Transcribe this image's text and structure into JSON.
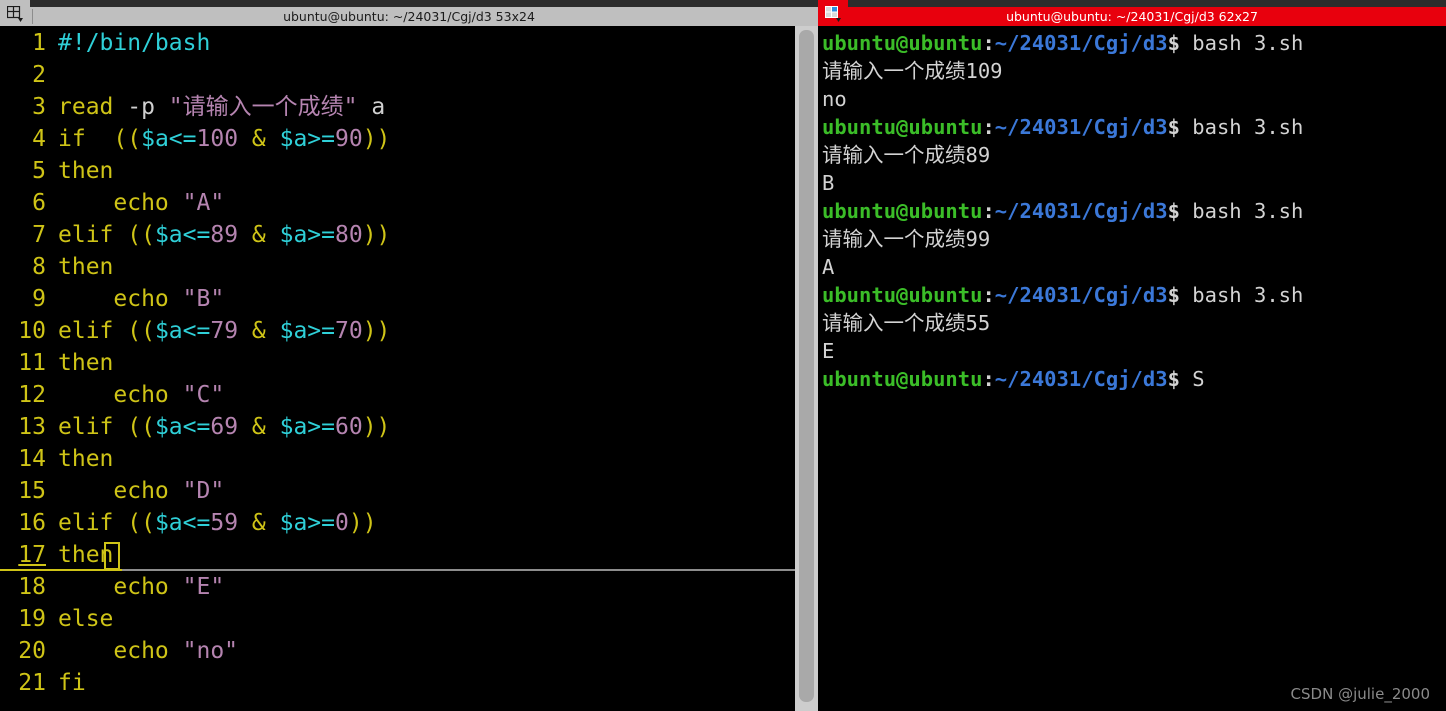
{
  "desktop": {
    "background_color": "#000000",
    "watermark": "CSDN @julie_2000"
  },
  "vim_window": {
    "title": "ubuntu@ubuntu: ~/24031/Cgj/d3 53x24",
    "titlebar_color": "#bfbfbf",
    "state": "inactive",
    "menu_icon": "window-menu-icon",
    "filename_hint": "3.sh",
    "cursor": {
      "line": 17,
      "column": 4,
      "char": "n"
    },
    "lines": [
      {
        "n": "1",
        "tokens": [
          {
            "t": "#!/bin/bash",
            "c": "c-cmt"
          }
        ]
      },
      {
        "n": "2",
        "tokens": []
      },
      {
        "n": "3",
        "tokens": [
          {
            "t": "read",
            "c": "c-kw"
          },
          {
            "t": " -p ",
            "c": "c-plain"
          },
          {
            "t": "\"请输入一个成绩\"",
            "c": "c-str"
          },
          {
            "t": " a",
            "c": "c-plain"
          }
        ]
      },
      {
        "n": "4",
        "tokens": [
          {
            "t": "if",
            "c": "c-kw"
          },
          {
            "t": "  ",
            "c": "c-plain"
          },
          {
            "t": "((",
            "c": "c-kw"
          },
          {
            "t": "$a<=",
            "c": "c-var"
          },
          {
            "t": "100",
            "c": "c-num"
          },
          {
            "t": " & ",
            "c": "c-kw"
          },
          {
            "t": "$a>=",
            "c": "c-var"
          },
          {
            "t": "90",
            "c": "c-num"
          },
          {
            "t": "))",
            "c": "c-kw"
          }
        ]
      },
      {
        "n": "5",
        "tokens": [
          {
            "t": "then",
            "c": "c-kw"
          }
        ]
      },
      {
        "n": "6",
        "tokens": [
          {
            "t": "    ",
            "c": "c-plain"
          },
          {
            "t": "echo",
            "c": "c-kw"
          },
          {
            "t": " ",
            "c": "c-plain"
          },
          {
            "t": "\"A\"",
            "c": "c-str"
          }
        ]
      },
      {
        "n": "7",
        "tokens": [
          {
            "t": "elif",
            "c": "c-kw"
          },
          {
            "t": " ",
            "c": "c-plain"
          },
          {
            "t": "((",
            "c": "c-kw"
          },
          {
            "t": "$a<=",
            "c": "c-var"
          },
          {
            "t": "89",
            "c": "c-num"
          },
          {
            "t": " & ",
            "c": "c-kw"
          },
          {
            "t": "$a>=",
            "c": "c-var"
          },
          {
            "t": "80",
            "c": "c-num"
          },
          {
            "t": "))",
            "c": "c-kw"
          }
        ]
      },
      {
        "n": "8",
        "tokens": [
          {
            "t": "then",
            "c": "c-kw"
          }
        ]
      },
      {
        "n": "9",
        "tokens": [
          {
            "t": "    ",
            "c": "c-plain"
          },
          {
            "t": "echo",
            "c": "c-kw"
          },
          {
            "t": " ",
            "c": "c-plain"
          },
          {
            "t": "\"B\"",
            "c": "c-str"
          }
        ]
      },
      {
        "n": "10",
        "tokens": [
          {
            "t": "elif",
            "c": "c-kw"
          },
          {
            "t": " ",
            "c": "c-plain"
          },
          {
            "t": "((",
            "c": "c-kw"
          },
          {
            "t": "$a<=",
            "c": "c-var"
          },
          {
            "t": "79",
            "c": "c-num"
          },
          {
            "t": " & ",
            "c": "c-kw"
          },
          {
            "t": "$a>=",
            "c": "c-var"
          },
          {
            "t": "70",
            "c": "c-num"
          },
          {
            "t": "))",
            "c": "c-kw"
          }
        ]
      },
      {
        "n": "11",
        "tokens": [
          {
            "t": "then",
            "c": "c-kw"
          }
        ]
      },
      {
        "n": "12",
        "tokens": [
          {
            "t": "    ",
            "c": "c-plain"
          },
          {
            "t": "echo",
            "c": "c-kw"
          },
          {
            "t": " ",
            "c": "c-plain"
          },
          {
            "t": "\"C\"",
            "c": "c-str"
          }
        ]
      },
      {
        "n": "13",
        "tokens": [
          {
            "t": "elif",
            "c": "c-kw"
          },
          {
            "t": " ",
            "c": "c-plain"
          },
          {
            "t": "((",
            "c": "c-kw"
          },
          {
            "t": "$a<=",
            "c": "c-var"
          },
          {
            "t": "69",
            "c": "c-num"
          },
          {
            "t": " & ",
            "c": "c-kw"
          },
          {
            "t": "$a>=",
            "c": "c-var"
          },
          {
            "t": "60",
            "c": "c-num"
          },
          {
            "t": "))",
            "c": "c-kw"
          }
        ]
      },
      {
        "n": "14",
        "tokens": [
          {
            "t": "then",
            "c": "c-kw"
          }
        ]
      },
      {
        "n": "15",
        "tokens": [
          {
            "t": "    ",
            "c": "c-plain"
          },
          {
            "t": "echo",
            "c": "c-kw"
          },
          {
            "t": " ",
            "c": "c-plain"
          },
          {
            "t": "\"D\"",
            "c": "c-str"
          }
        ]
      },
      {
        "n": "16",
        "tokens": [
          {
            "t": "elif",
            "c": "c-kw"
          },
          {
            "t": " ",
            "c": "c-plain"
          },
          {
            "t": "((",
            "c": "c-kw"
          },
          {
            "t": "$a<=",
            "c": "c-var"
          },
          {
            "t": "59",
            "c": "c-num"
          },
          {
            "t": " & ",
            "c": "c-kw"
          },
          {
            "t": "$a>=",
            "c": "c-var"
          },
          {
            "t": "0",
            "c": "c-num"
          },
          {
            "t": "))",
            "c": "c-kw"
          }
        ]
      },
      {
        "n": "17",
        "tokens": [
          {
            "t": "then",
            "c": "c-kw"
          }
        ],
        "cursorline": true
      },
      {
        "n": "18",
        "tokens": [
          {
            "t": "    ",
            "c": "c-plain"
          },
          {
            "t": "echo",
            "c": "c-kw"
          },
          {
            "t": " ",
            "c": "c-plain"
          },
          {
            "t": "\"E\"",
            "c": "c-str"
          }
        ]
      },
      {
        "n": "19",
        "tokens": [
          {
            "t": "else",
            "c": "c-kw"
          }
        ]
      },
      {
        "n": "20",
        "tokens": [
          {
            "t": "    ",
            "c": "c-plain"
          },
          {
            "t": "echo",
            "c": "c-kw"
          },
          {
            "t": " ",
            "c": "c-plain"
          },
          {
            "t": "\"no\"",
            "c": "c-str"
          }
        ]
      },
      {
        "n": "21",
        "tokens": [
          {
            "t": "fi",
            "c": "c-kw"
          }
        ]
      }
    ]
  },
  "terminal_window": {
    "title": "ubuntu@ubuntu: ~/24031/Cgj/d3 62x27",
    "titlebar_color": "#e8000d",
    "state": "active",
    "menu_icon": "window-menu-icon",
    "prompt": {
      "user_host": "ubuntu@ubuntu",
      "colon": ":",
      "path": "~/24031/Cgj/d3",
      "sigil": "$"
    },
    "lines": [
      {
        "type": "prompt",
        "command": " bash 3.sh"
      },
      {
        "type": "output",
        "text": "请输入一个成绩109"
      },
      {
        "type": "output",
        "text": "no"
      },
      {
        "type": "prompt",
        "command": " bash 3.sh"
      },
      {
        "type": "output",
        "text": "请输入一个成绩89"
      },
      {
        "type": "output",
        "text": "B"
      },
      {
        "type": "prompt",
        "command": " bash 3.sh"
      },
      {
        "type": "output",
        "text": "请输入一个成绩99"
      },
      {
        "type": "output",
        "text": "A"
      },
      {
        "type": "prompt",
        "command": " bash 3.sh"
      },
      {
        "type": "output",
        "text": "请输入一个成绩55"
      },
      {
        "type": "output",
        "text": "E"
      },
      {
        "type": "prompt",
        "command": " S"
      }
    ]
  }
}
